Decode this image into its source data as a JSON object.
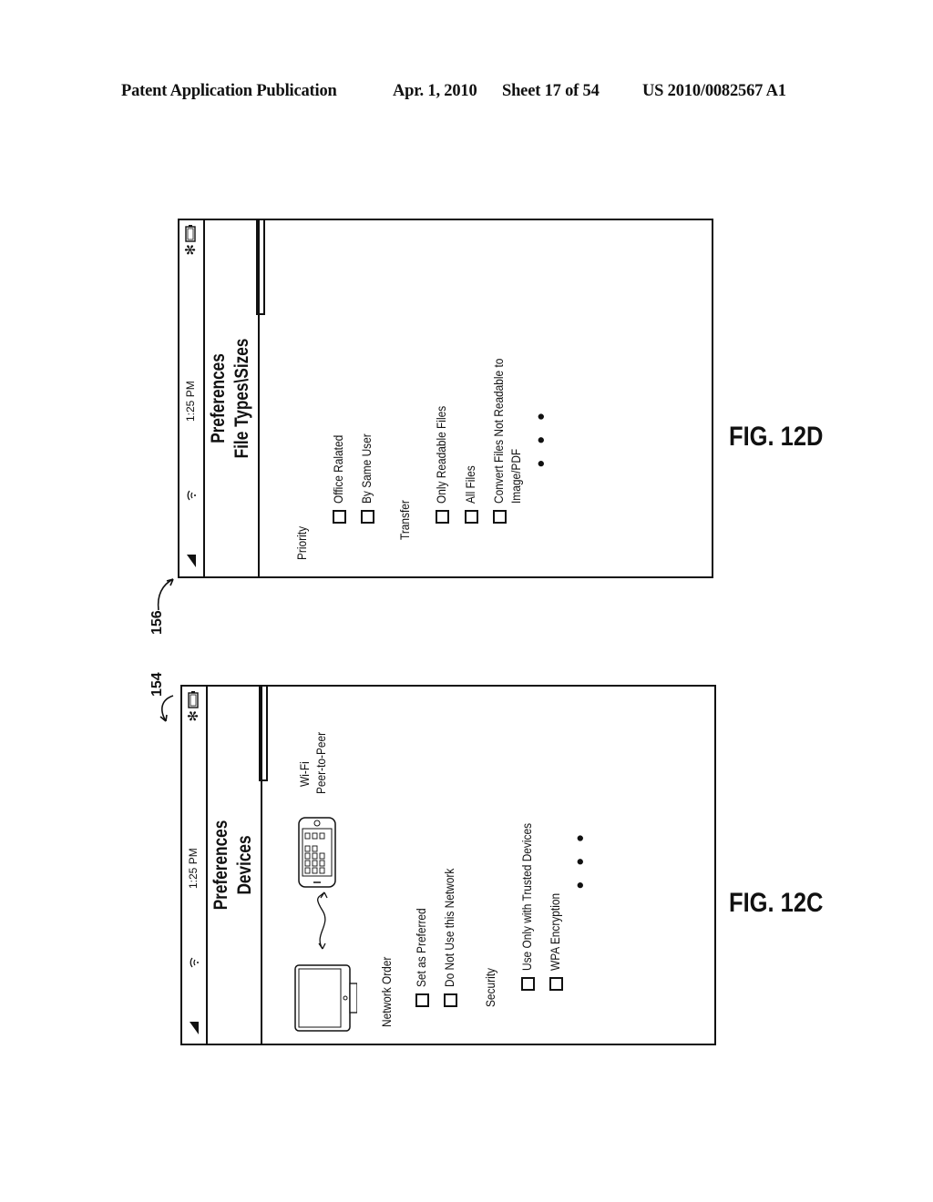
{
  "header": {
    "publication": "Patent Application Publication",
    "date": "Apr. 1, 2010",
    "sheet": "Sheet 17 of 54",
    "number": "US 2010/0082567 A1"
  },
  "references": {
    "ref_154": "154",
    "ref_156": "156"
  },
  "fig12c": {
    "caption": "FIG. 12C",
    "status": {
      "time": "1:25 PM"
    },
    "title_line1": "Preferences",
    "title_line2": "Devices",
    "connection_label_1": "Wi-Fi",
    "connection_label_2": "Peer-to-Peer",
    "sections": [
      {
        "heading": "Network Order",
        "options": [
          "Set as Preferred",
          "Do Not Use this Network"
        ]
      },
      {
        "heading": "Security",
        "options": [
          "Use Only with Trusted Devices",
          "WPA Encryption"
        ]
      }
    ],
    "more": "• • •"
  },
  "fig12d": {
    "caption": "FIG. 12D",
    "status": {
      "time": "1:25 PM"
    },
    "title_line1": "Preferences",
    "title_line2": "File Types\\Sizes",
    "sections": [
      {
        "heading": "Priority",
        "options": [
          "Office Ralated",
          "By Same User"
        ]
      },
      {
        "heading": "Transfer",
        "options": [
          "Only Readable Files",
          "All Files",
          "Convert Files Not Readable to",
          "Image/PDF"
        ]
      }
    ],
    "more": "• • •"
  },
  "icons": [
    "signal-icon",
    "wifi-icon",
    "bluetooth-icon",
    "battery-icon",
    "computer-icon",
    "phone-icon",
    "wireless-link-arrow-icon"
  ]
}
